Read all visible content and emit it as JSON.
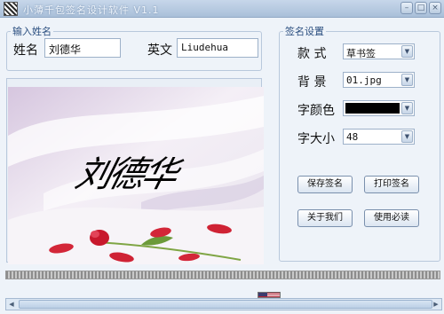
{
  "window": {
    "title": "小薄千包签名设计软件 V1.1",
    "controls": {
      "minimize": "–",
      "maximize": "□",
      "close": "×"
    }
  },
  "name_group": {
    "legend": "输入姓名",
    "name_label": "姓名",
    "name_value": "刘德华",
    "english_label": "英文",
    "english_value": "Liudehua"
  },
  "preview": {
    "signature_text": "刘德华"
  },
  "settings_group": {
    "legend": "签名设置",
    "style_label": "款  式",
    "style_value": "草书签",
    "background_label": "背  景",
    "background_value": "01.jpg",
    "color_label": "字颜色",
    "color_value": "#000000",
    "size_label": "字大小",
    "size_value": "48"
  },
  "buttons": {
    "save": "保存签名",
    "print": "打印签名",
    "about": "关于我们",
    "help": "使用必读"
  }
}
